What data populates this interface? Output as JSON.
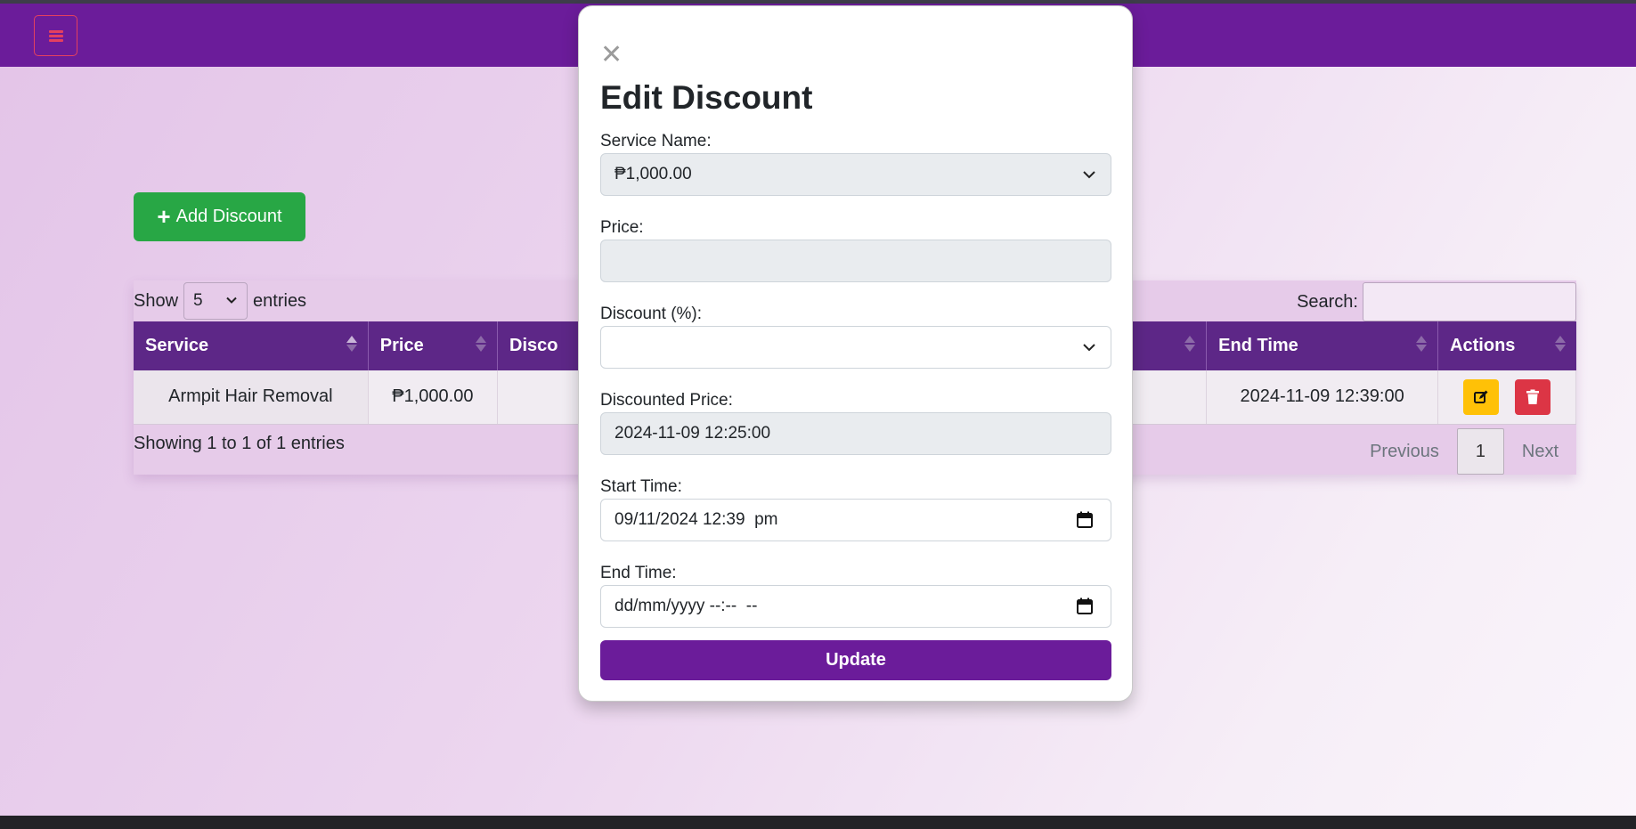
{
  "navbar": {
    "menu_icon": "hamburger-icon",
    "accent": "#6b1c9a"
  },
  "add_button": {
    "icon": "plus-icon",
    "label": "Add Discount"
  },
  "table": {
    "show_label": "Show",
    "entries_label": "entries",
    "page_length": "5",
    "search_label": "Search:",
    "search_value": "",
    "columns": [
      "Service",
      "Price",
      "Disco",
      "",
      "End Time",
      "Actions"
    ],
    "rows": [
      {
        "service": "Armpit Hair Removal",
        "price": "₱1,000.00",
        "end_time": "2024-11-09 12:39:00"
      }
    ],
    "info": "Showing 1 to 1 of 1 entries",
    "pagination": {
      "previous": "Previous",
      "current": "1",
      "next": "Next"
    }
  },
  "modal": {
    "close_icon": "close-icon",
    "title": "Edit Discount",
    "service_name_label": "Service Name:",
    "service_name_value": "₱1,000.00",
    "price_label": "Price:",
    "price_value": "",
    "discount_label": "Discount (%):",
    "discount_value": "",
    "discounted_price_label": "Discounted Price:",
    "discounted_price_value": "2024-11-09 12:25:00",
    "start_time_label": "Start Time:",
    "start_time_value": "09/11/2024 12:39  pm",
    "end_time_label": "End Time:",
    "end_time_value": "dd/mm/yyyy --:--  --",
    "update_label": "Update"
  }
}
